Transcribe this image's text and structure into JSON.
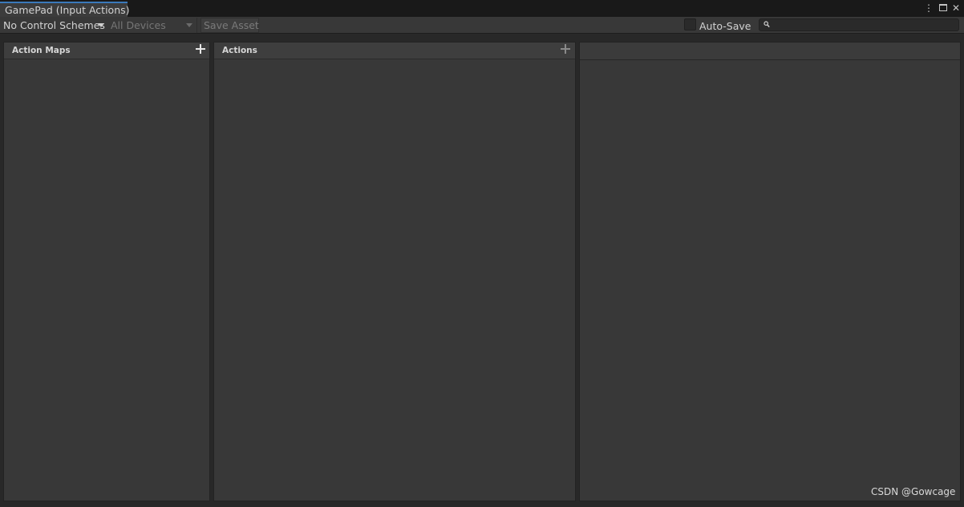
{
  "tab": {
    "title": "GamePad (Input Actions)"
  },
  "window_controls": {
    "more_icon": "kebab-menu-icon",
    "maximize_icon": "maximize-icon",
    "close_icon": "close-icon"
  },
  "toolbar": {
    "control_scheme": "No Control Schemes",
    "devices": "All Devices",
    "save_label": "Save Asset",
    "autosave_label": "Auto-Save",
    "autosave_checked": false,
    "search_placeholder": ""
  },
  "panels": {
    "action_maps": {
      "title": "Action Maps",
      "add_icon": "plus-icon",
      "items": []
    },
    "actions": {
      "title": "Actions",
      "add_icon": "plus-icon",
      "items": []
    },
    "properties": {
      "title": ""
    }
  },
  "watermark": "CSDN @Gowcage",
  "colors": {
    "tab_accent": "#3a79bb",
    "panel_bg": "#383838",
    "window_bg": "#282828"
  }
}
